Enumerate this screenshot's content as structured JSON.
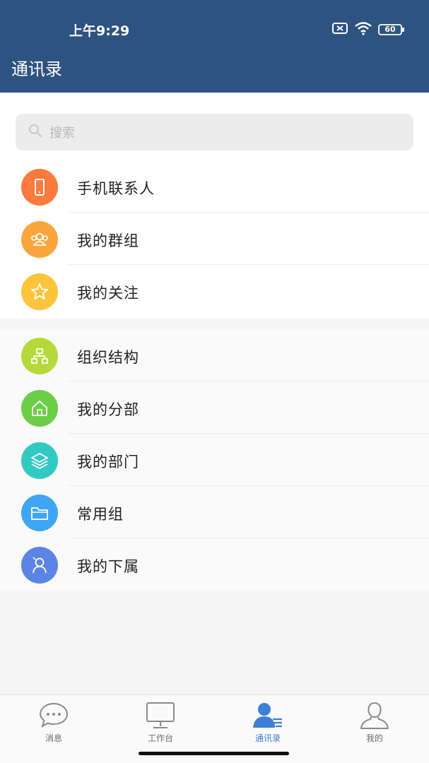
{
  "status_bar": {
    "time": "上午9:29",
    "battery": "60",
    "icons": [
      "sim-off-icon",
      "wifi-icon",
      "battery-icon"
    ]
  },
  "header": {
    "title": "通讯录"
  },
  "search": {
    "placeholder": "搜索"
  },
  "groups": [
    {
      "items": [
        {
          "label": "手机联系人",
          "icon": "phone-icon",
          "color": "#fb7a3d"
        },
        {
          "label": "我的群组",
          "icon": "group-icon",
          "color": "#fba63c"
        },
        {
          "label": "我的关注",
          "icon": "star-icon",
          "color": "#fcc43b"
        }
      ]
    },
    {
      "items": [
        {
          "label": "组织结构",
          "icon": "org-chart-icon",
          "color": "#b5d93a"
        },
        {
          "label": "我的分部",
          "icon": "house-icon",
          "color": "#6cce46"
        },
        {
          "label": "我的部门",
          "icon": "layers-icon",
          "color": "#33c9c3"
        },
        {
          "label": "常用组",
          "icon": "folder-icon",
          "color": "#3ea6f5"
        },
        {
          "label": "我的下属",
          "icon": "subordinate-icon",
          "color": "#5b84e5"
        }
      ]
    }
  ],
  "bottom_nav": {
    "tabs": [
      {
        "label": "消息",
        "icon": "chat-bubble-icon",
        "active": false
      },
      {
        "label": "工作台",
        "icon": "monitor-icon",
        "active": false
      },
      {
        "label": "通讯录",
        "icon": "contacts-icon",
        "active": true
      },
      {
        "label": "我的",
        "icon": "user-icon",
        "active": false
      }
    ]
  },
  "colors": {
    "header_bg": "#2e5381",
    "accent": "#3d7fd6"
  }
}
